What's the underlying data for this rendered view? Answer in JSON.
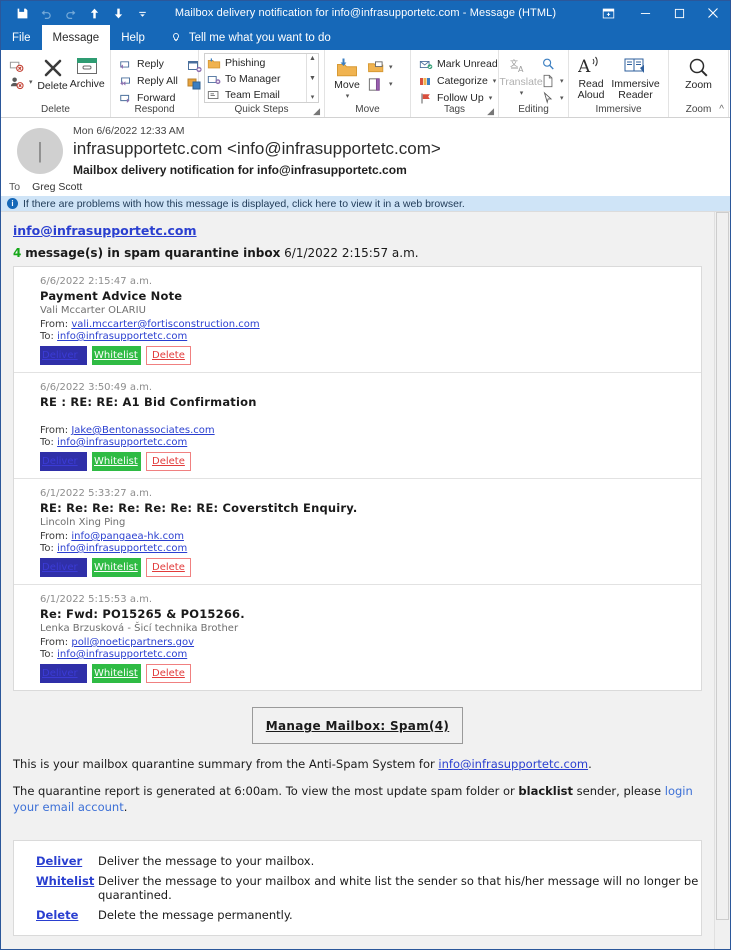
{
  "window": {
    "title": "Mailbox delivery notification for info@infrasupportetc.com  -  Message (HTML)",
    "quick_access": [
      {
        "name": "save-icon",
        "label": "Save"
      },
      {
        "name": "undo-icon",
        "label": "Undo"
      },
      {
        "name": "redo-icon",
        "label": "Redo"
      },
      {
        "name": "previous-item-icon",
        "label": "Previous Item"
      },
      {
        "name": "next-item-icon",
        "label": "Next Item"
      },
      {
        "name": "customize-quick-access-toolbar-icon",
        "label": "Customize Quick Access Toolbar"
      }
    ],
    "controls": {
      "ribbon_display": "Ribbon Display Options",
      "minimize": "Minimize",
      "maximize": "Maximize",
      "close": "Close"
    }
  },
  "tabs": [
    {
      "label": "File",
      "active": false
    },
    {
      "label": "Message",
      "active": true
    },
    {
      "label": "Help",
      "active": false
    }
  ],
  "tellme": {
    "placeholder": "Tell me what you want to do"
  },
  "ribbon": {
    "collapse_label": "Collapse the Ribbon",
    "groups": [
      {
        "label": "Delete",
        "small_buttons": [
          {
            "label": "",
            "icon": "ignore-icon"
          },
          {
            "label": "",
            "icon": "junk-icon",
            "caret": true
          }
        ],
        "big_buttons": [
          {
            "label": "Delete",
            "icon": "delete-x-icon"
          },
          {
            "label": "Archive",
            "icon": "archive-icon"
          }
        ]
      },
      {
        "label": "Respond",
        "small_buttons": [
          {
            "label": "Reply",
            "icon": "reply-icon"
          },
          {
            "label": "Reply All",
            "icon": "reply-all-icon"
          },
          {
            "label": "Forward",
            "icon": "forward-icon"
          }
        ],
        "extra": [
          {
            "label": "",
            "icon": "meeting-icon"
          },
          {
            "label": "",
            "icon": "more-respond-icon",
            "caret": true
          }
        ]
      },
      {
        "label": "Quick Steps",
        "dialog_launcher": true,
        "items": [
          {
            "label": "Phishing",
            "icon": "phishing-folder-icon"
          },
          {
            "label": "To Manager",
            "icon": "to-manager-icon"
          },
          {
            "label": "Team Email",
            "icon": "team-email-icon"
          }
        ]
      },
      {
        "label": "Move",
        "big_buttons": [
          {
            "label": "Move",
            "icon": "move-folder-icon",
            "caret": true
          }
        ],
        "small_buttons": [
          {
            "label": "",
            "icon": "rules-icon",
            "caret": true
          },
          {
            "label": "",
            "icon": "onenote-icon",
            "caret": true
          }
        ]
      },
      {
        "label": "Tags",
        "dialog_launcher": true,
        "small_buttons": [
          {
            "label": "Mark Unread",
            "icon": "mark-unread-icon"
          },
          {
            "label": "Categorize",
            "icon": "categorize-icon",
            "caret": true
          },
          {
            "label": "Follow Up",
            "icon": "follow-up-flag-icon",
            "caret": true
          }
        ]
      },
      {
        "label": "Editing",
        "big_buttons": [
          {
            "label": "Translate",
            "icon": "translate-icon",
            "disabled": true,
            "caret": true
          }
        ],
        "small_buttons": [
          {
            "label": "",
            "icon": "find-icon"
          },
          {
            "label": "",
            "icon": "select-page-icon",
            "caret": true
          },
          {
            "label": "",
            "icon": "select-pointer-icon",
            "caret": true
          }
        ]
      },
      {
        "label": "Immersive",
        "big_buttons": [
          {
            "label": "Read\nAloud",
            "icon": "read-aloud-icon"
          },
          {
            "label": "Immersive\nReader",
            "icon": "immersive-reader-icon"
          }
        ]
      },
      {
        "label": "Zoom",
        "big_buttons": [
          {
            "label": "Zoom",
            "icon": "zoom-magnifier-icon"
          }
        ]
      }
    ]
  },
  "message_header": {
    "date": "Mon 6/6/2022 12:33 AM",
    "from": "infrasupportetc.com <info@infrasupportetc.com>",
    "subject": "Mailbox delivery notification for info@infrasupportetc.com",
    "to_label": "To",
    "to_value": "Greg Scott",
    "infobar": "If there are problems with how this message is displayed, click here to view it in a web browser."
  },
  "email_body": {
    "account_link": "info@infrasupportetc.com",
    "count": "4",
    "count_text": "message(s) in spam quarantine inbox",
    "count_timestamp": "6/1/2022 2:15:57 a.m.",
    "actions": {
      "deliver": "Deliver",
      "whitelist": "Whitelist",
      "delete": "Delete"
    },
    "labels": {
      "from": "From:",
      "to": "To:"
    },
    "messages": [
      {
        "date": "6/6/2022 2:15:47 a.m.",
        "subject": "Payment Advice Note",
        "sender_name": "Vali Mccarter OLARIU",
        "from": "vali.mccarter@fortisconstruction.com",
        "to": "info@infrasupportetc.com"
      },
      {
        "date": "6/6/2022 3:50:49 a.m.",
        "subject": "RE : RE: RE: A1 Bid Confirmation",
        "sender_name": "",
        "from": "Jake@Bentonassociates.com",
        "to": "info@infrasupportetc.com"
      },
      {
        "date": "6/1/2022 5:33:27 a.m.",
        "subject": "RE: Re: Re: Re: Re: Re: RE: Coverstitch Enquiry.",
        "sender_name": "Lincoln Xing Ping",
        "from": "info@pangaea-hk.com",
        "to": "info@infrasupportetc.com"
      },
      {
        "date": "6/1/2022 5:15:53 a.m.",
        "subject": "Re: Fwd: PO15265 & PO15266.",
        "sender_name": "Lenka Brzusková - Šicí technika Brother",
        "from": "poll@noeticpartners.gov",
        "to": "info@infrasupportetc.com"
      }
    ],
    "manage_button": "Manage Mailbox: Spam(4)",
    "summary_line_prefix": "This is your mailbox quarantine summary from the Anti-Spam System for ",
    "summary_line_link": "info@infrasupportetc.com",
    "summary_line_suffix": ".",
    "report_line_1": "The quarantine report is generated at 6:00am. To view the most update spam folder or ",
    "report_line_bold": "blacklist",
    "report_line_2": " sender, please ",
    "report_line_link": "login your email account",
    "report_line_end": ".",
    "legend": [
      {
        "term": "Deliver",
        "definition": "Deliver the message to your mailbox."
      },
      {
        "term": "Whitelist",
        "definition": "Deliver the message to your mailbox and white list the sender so that his/her message will no longer be quarantined."
      },
      {
        "term": "Delete",
        "definition": "Delete the message permanently."
      }
    ]
  },
  "colors": {
    "titlebar": "#1668b8",
    "deliver_bg": "#2f2fa8",
    "whitelist_bg": "#2fbb44",
    "delete_border": "#f08080",
    "link": "#2a3fd0",
    "count_green": "#17a81a"
  }
}
